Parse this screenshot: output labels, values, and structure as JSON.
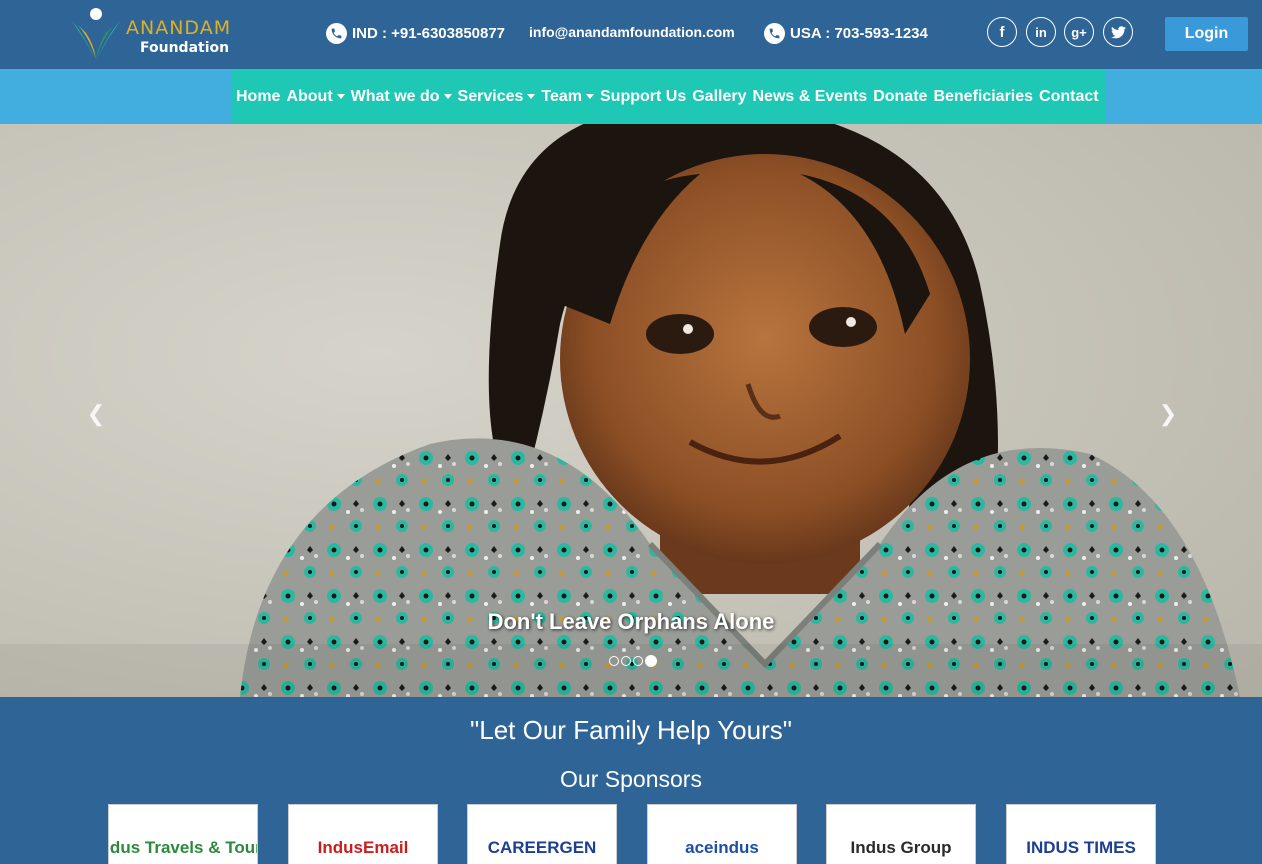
{
  "header": {
    "logo": {
      "name": "ANANDAM",
      "sub": "Foundation"
    },
    "phone_ind": "IND : +91-6303850877",
    "email": "info@anandamfoundation.com",
    "phone_usa": "USA : 703-593-1234",
    "social": [
      {
        "icon": "facebook-icon",
        "glyph": "f"
      },
      {
        "icon": "linkedin-icon",
        "glyph": "in"
      },
      {
        "icon": "google-plus-icon",
        "glyph": "g+"
      },
      {
        "icon": "twitter-icon",
        "glyph": "t"
      }
    ],
    "login_label": "Login"
  },
  "nav": {
    "items": [
      {
        "label": "Home",
        "dropdown": false
      },
      {
        "label": "About",
        "dropdown": true
      },
      {
        "label": "What we do",
        "dropdown": true
      },
      {
        "label": "Services",
        "dropdown": true
      },
      {
        "label": "Team",
        "dropdown": true
      },
      {
        "label": "Support Us",
        "dropdown": false
      },
      {
        "label": "Gallery",
        "dropdown": false
      },
      {
        "label": "News & Events",
        "dropdown": false
      },
      {
        "label": "Donate",
        "dropdown": false
      },
      {
        "label": "Beneficiaries",
        "dropdown": false
      },
      {
        "label": "Contact",
        "dropdown": false
      }
    ]
  },
  "hero": {
    "caption": "Don't Leave Orphans Alone",
    "slide_count": 4,
    "active_slide": 4
  },
  "tagline": "\"Let Our Family Help Yours\"",
  "sponsors": {
    "title": "Our Sponsors",
    "items": [
      {
        "name": "Indus Travels & Tours",
        "color": "#2d8a3c"
      },
      {
        "name": "IndusEmail",
        "color": "#c81e1e"
      },
      {
        "name": "CAREERGEN",
        "color": "#1d3f8f"
      },
      {
        "name": "aceindus",
        "color": "#1d4fa8"
      },
      {
        "name": "Indus Group",
        "color": "#2a2a2a"
      },
      {
        "name": "INDUS TIMES",
        "color": "#1d3f8f"
      }
    ]
  },
  "colors": {
    "header_bg": "#2f6496",
    "nav_bg": "#1fc8b4",
    "nav_strip": "#42aee0",
    "login_bg": "#3a9ad9"
  }
}
